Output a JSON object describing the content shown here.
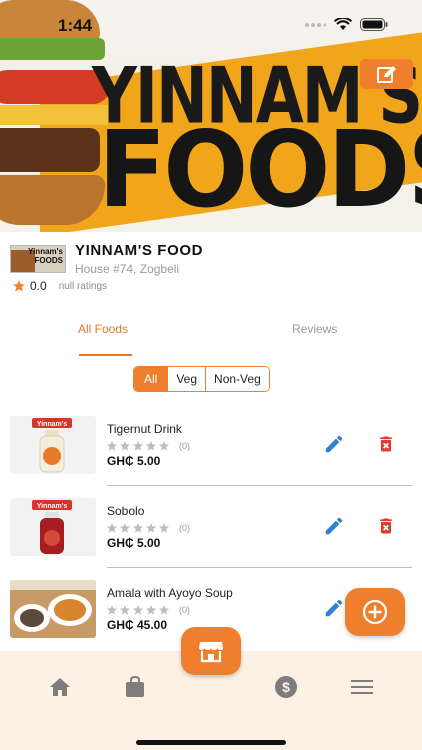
{
  "status_bar": {
    "time": "1:44"
  },
  "banner": {
    "brand_top": "YINNAM'S",
    "brand_big": "FOODS"
  },
  "restaurant": {
    "logo_text": "Yinnam's FOODS",
    "name": "YINNAM'S FOOD",
    "address": "House #74, Zogbeli",
    "rating_value": "0.0",
    "rating_label": "null ratings"
  },
  "tabs": [
    {
      "label": "All Foods",
      "active": true
    },
    {
      "label": "Reviews",
      "active": false
    }
  ],
  "filter": {
    "options": [
      "All",
      "Veg",
      "Non-Veg"
    ],
    "selected": "All"
  },
  "foods": [
    {
      "name": "Tigernut Drink",
      "rating": 0,
      "rating_count": "(0)",
      "price": "GH₵ 5.00",
      "thumb_label": "Yinnam's"
    },
    {
      "name": "Sobolo",
      "rating": 0,
      "rating_count": "(0)",
      "price": "GH₵ 5.00",
      "thumb_label": "Yinnam's"
    },
    {
      "name": "Amala with Ayoyo Soup",
      "rating": 0,
      "rating_count": "(0)",
      "price": "GH₵ 45.00",
      "thumb_label": ""
    }
  ],
  "bottom_nav": {
    "items": [
      "home-icon",
      "bag-icon",
      "store-icon",
      "dollar-icon",
      "menu-icon"
    ]
  },
  "colors": {
    "accent": "#ef7f2c",
    "edit_blue": "#2f80d1",
    "delete_red": "#e03b30",
    "star_gray": "#bdbdbd",
    "nav_bg": "#fdf0e4"
  }
}
